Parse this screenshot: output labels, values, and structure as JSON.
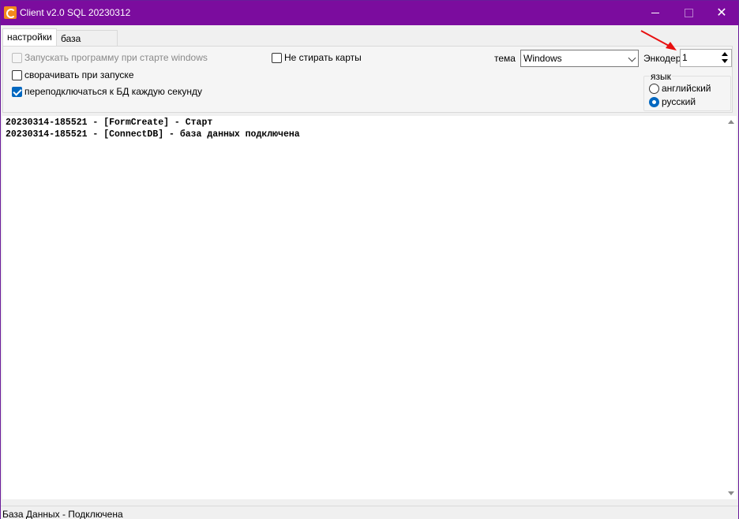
{
  "window": {
    "title": "Client v2.0 SQL 20230312",
    "close_glyph": "✕"
  },
  "tabs": [
    {
      "label": "настройки",
      "active": true
    },
    {
      "label": "база данных",
      "active": false
    }
  ],
  "settings": {
    "autostart_label": "Запускать программу при старте windows",
    "autostart_checked": false,
    "autostart_enabled": false,
    "minimize_label": "сворачивать при запуске",
    "minimize_checked": false,
    "reconnect_label": "переподключаться к БД каждую секунду",
    "reconnect_checked": true,
    "keep_cards_label": "Не стирать карты",
    "keep_cards_checked": false,
    "theme_label": "тема",
    "theme_value": "Windows",
    "encoder_label": "Энкодер",
    "encoder_value": "1",
    "language_title": "язык",
    "language_options": [
      {
        "label": "английский",
        "selected": false
      },
      {
        "label": "русский",
        "selected": true
      }
    ]
  },
  "log": {
    "lines": [
      "20230314-185521 - [FormCreate] - Старт",
      "20230314-185521 - [ConnectDB] - база данных подключена"
    ]
  },
  "status_bar": {
    "text": "База Данных - Подключена"
  },
  "colors": {
    "titlebar": "#7b0c9e",
    "accent": "#0067c0",
    "annotation_arrow": "#e81010"
  },
  "icons": {
    "app": "app-key-icon",
    "minimize": "minimize-icon",
    "maximize": "maximize-icon",
    "close": "close-icon"
  }
}
